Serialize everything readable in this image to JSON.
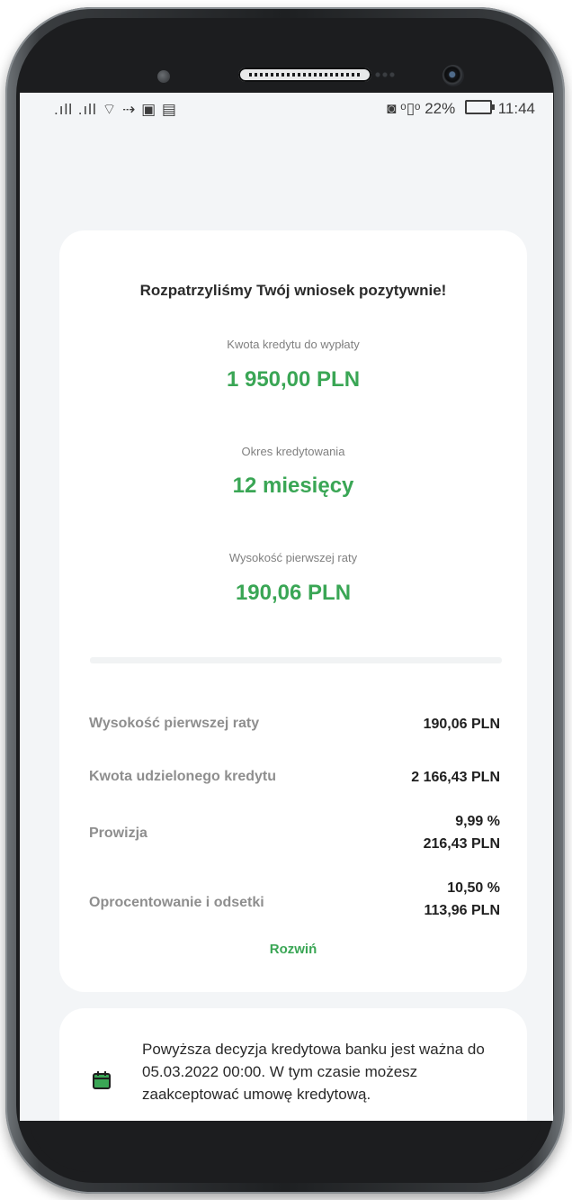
{
  "status_bar": {
    "left_icons": ".ıll .ıll ⌔ ⇢ ▣ ▤",
    "right_icons": "◙ ᵒ▯ᵒ",
    "battery_percent": "22%",
    "time": "11:44"
  },
  "decision": {
    "headline": "Rozpatrzyliśmy Twój wniosek pozytywnie!",
    "summary": [
      {
        "label": "Kwota kredytu do wypłaty",
        "value": "1 950,00 PLN"
      },
      {
        "label": "Okres kredytowania",
        "value": "12 miesięcy"
      },
      {
        "label": "Wysokość pierwszej raty",
        "value": "190,06 PLN"
      }
    ],
    "details": [
      {
        "label": "Wysokość pierwszej raty",
        "value": "190,06 PLN"
      },
      {
        "label": "Kwota udzielonego kredytu",
        "value": "2 166,43 PLN"
      },
      {
        "label": "Prowizja",
        "value_line1": "9,99 %",
        "value_line2": "216,43 PLN"
      },
      {
        "label": "Oprocentowanie i odsetki",
        "value_line1": "10,50 %",
        "value_line2": "113,96 PLN"
      }
    ],
    "expand_label": "Rozwiń"
  },
  "info": {
    "icon": "calendar-icon",
    "text": "Powyższa decyzja kredytowa banku jest ważna do 05.03.2022 00:00. W tym czasie możesz zaakceptować umowę kredytową."
  },
  "colors": {
    "accent": "#3aa655",
    "background": "#f3f5f7",
    "card": "#ffffff"
  }
}
